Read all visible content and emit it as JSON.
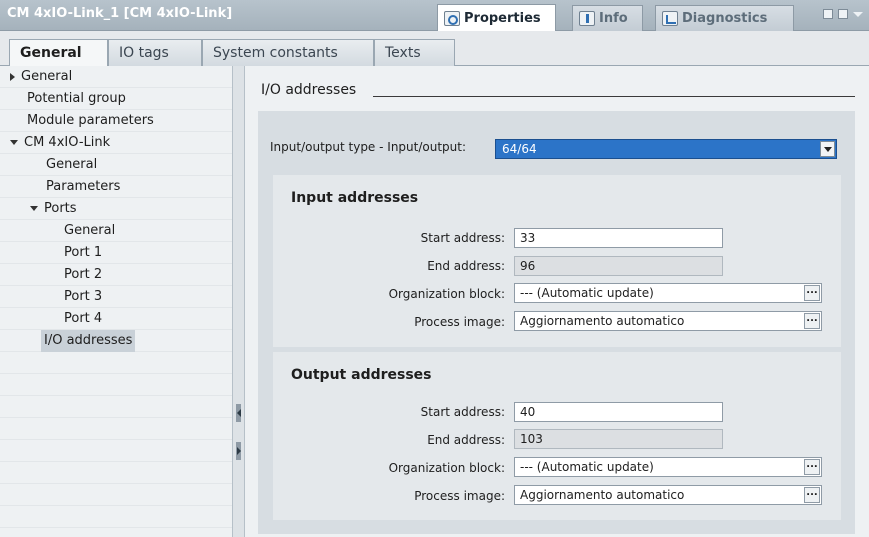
{
  "window": {
    "title": "CM 4xIO-Link_1 [CM 4xIO-Link]",
    "top_tabs": [
      {
        "label": "Properties",
        "icon": "properties-icon",
        "active": true
      },
      {
        "label": "Info",
        "icon": "info-icon",
        "active": false
      },
      {
        "label": "Diagnostics",
        "icon": "diagnostics-icon",
        "active": false
      }
    ]
  },
  "tabs": [
    {
      "label": "General",
      "active": true
    },
    {
      "label": "IO tags",
      "active": false
    },
    {
      "label": "System constants",
      "active": false
    },
    {
      "label": "Texts",
      "active": false
    }
  ],
  "tree": [
    {
      "label": "General",
      "expander": "collapsed"
    },
    {
      "label": "Potential group"
    },
    {
      "label": "Module parameters"
    },
    {
      "label": "CM 4xIO-Link",
      "expander": "expanded"
    },
    {
      "label": "General"
    },
    {
      "label": "Parameters"
    },
    {
      "label": "Ports",
      "expander": "expanded"
    },
    {
      "label": "General"
    },
    {
      "label": "Port 1"
    },
    {
      "label": "Port 2"
    },
    {
      "label": "Port 3"
    },
    {
      "label": "Port 4"
    },
    {
      "label": "I/O addresses",
      "selected": true
    }
  ],
  "section": {
    "title": "I/O addresses",
    "io_type_label": "Input/output type - Input/output:",
    "io_type_value": "64/64"
  },
  "input": {
    "title": "Input addresses",
    "start_label": "Start address:",
    "start_value": "33",
    "end_label": "End address:",
    "end_value": "96",
    "ob_label": "Organization block:",
    "ob_value": "--- (Automatic update)",
    "pi_label": "Process image:",
    "pi_value": "Aggiornamento automatico"
  },
  "output": {
    "title": "Output addresses",
    "start_label": "Start address:",
    "start_value": "40",
    "end_label": "End address:",
    "end_value": "103",
    "ob_label": "Organization block:",
    "ob_value": "--- (Automatic update)",
    "pi_label": "Process image:",
    "pi_value": "Aggiornamento automatico"
  },
  "browse_button_label": "...",
  "colors": {
    "selected_dropdown": "#2c74c8",
    "titlebar": "#aab6c0"
  }
}
